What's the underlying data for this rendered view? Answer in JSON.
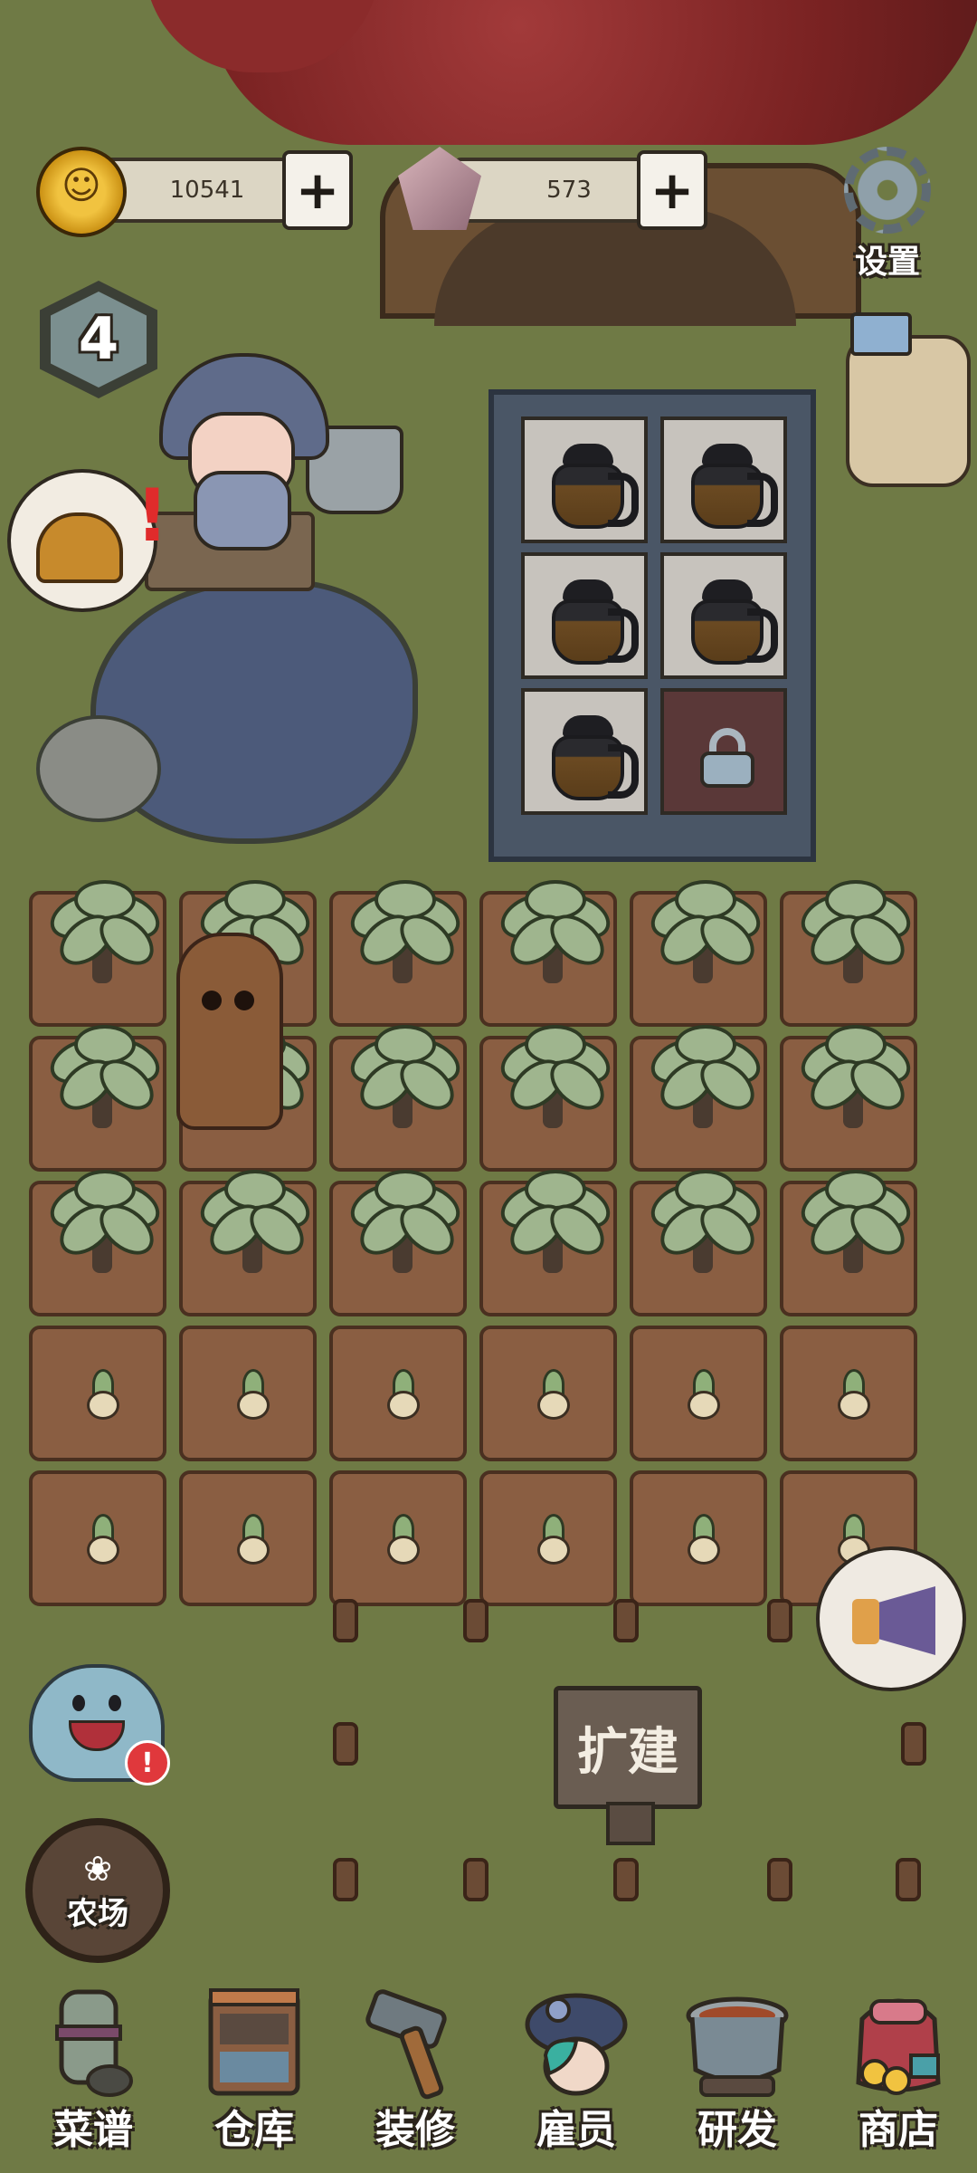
{
  "hud": {
    "coins": "10541",
    "gems": "573",
    "plus_symbol": "+",
    "settings_label": "设置",
    "level": "4"
  },
  "shelf": {
    "slots": [
      {
        "item": "coffee-pot"
      },
      {
        "item": "coffee-pot"
      },
      {
        "item": "coffee-pot"
      },
      {
        "item": "coffee-pot"
      },
      {
        "item": "coffee-pot"
      },
      {
        "item": "locked"
      }
    ]
  },
  "farm": {
    "rows": [
      [
        "palm",
        "palm",
        "palm",
        "palm",
        "palm",
        "palm"
      ],
      [
        "palm",
        "palm",
        "palm",
        "palm",
        "palm",
        "palm"
      ],
      [
        "palm",
        "palm",
        "palm",
        "palm",
        "palm",
        "palm"
      ],
      [
        "sprout",
        "sprout",
        "sprout",
        "sprout",
        "sprout",
        "sprout"
      ],
      [
        "sprout",
        "sprout",
        "sprout",
        "sprout",
        "sprout",
        "sprout"
      ]
    ],
    "expand_label": "扩建",
    "farm_button_label": "农场"
  },
  "alerts": {
    "ghost_badge": "!",
    "bell_badge": "!"
  },
  "nav": {
    "items": [
      {
        "label": "菜谱",
        "icon": "recipe-scroll-icon"
      },
      {
        "label": "仓库",
        "icon": "warehouse-cabinet-icon"
      },
      {
        "label": "装修",
        "icon": "hammer-icon"
      },
      {
        "label": "雇员",
        "icon": "employee-icon"
      },
      {
        "label": "研发",
        "icon": "cooking-pot-icon"
      },
      {
        "label": "商店",
        "icon": "shop-bag-icon"
      }
    ]
  },
  "colors": {
    "grass": "#6f7a45",
    "soil": "#8a5e42",
    "tree": "#7b2323",
    "alert": "#e0383c"
  }
}
